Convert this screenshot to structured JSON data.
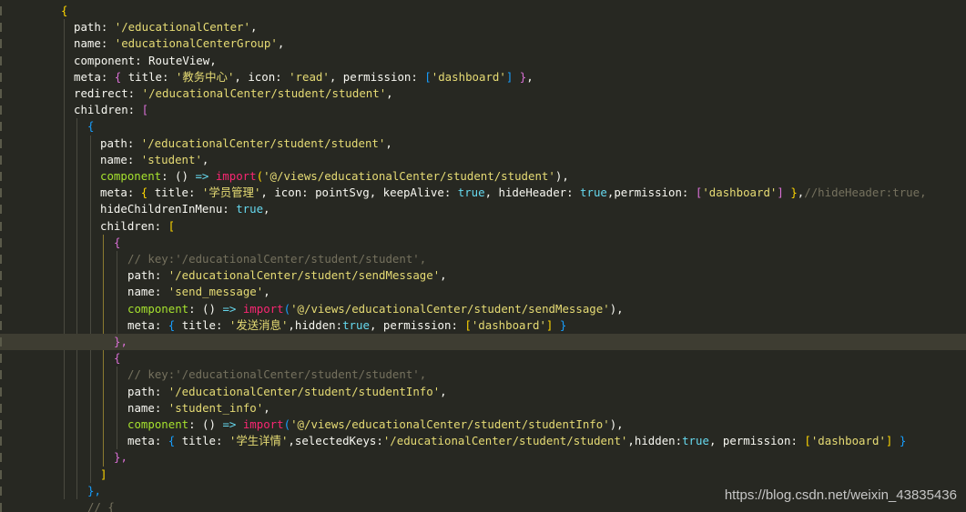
{
  "editor": {
    "theme_colors": {
      "background": "#272822",
      "string": "#e6db74",
      "keyword": "#66d9ef",
      "function": "#a6e22e",
      "comment": "#75715e",
      "import": "#f92672"
    },
    "lines": [
      [
        "{"
      ],
      [
        "path: ",
        "'/educationalCenter'",
        ","
      ],
      [
        "name: ",
        "'educationalCenterGroup'",
        ","
      ],
      [
        "component: RouteView,"
      ],
      [
        "meta: ",
        "{",
        " title: ",
        "'教务中心'",
        ", icon: ",
        "'read'",
        ", permission: ",
        "[",
        "'dashboard'",
        "]",
        " ",
        "}",
        ","
      ],
      [
        "redirect: ",
        "'/educationalCenter/student/student'",
        ","
      ],
      [
        "children: ",
        "["
      ],
      [
        "{"
      ],
      [
        "path: ",
        "'/educationalCenter/student/student'",
        ","
      ],
      [
        "name: ",
        "'student'",
        ","
      ],
      [
        "component",
        ": () ",
        "=>",
        " ",
        "import",
        "(",
        "'@/views/educationalCenter/student/student'",
        "),"
      ],
      [
        "meta: ",
        "{",
        " title: ",
        "'学员管理'",
        ", icon: pointSvg, keepAlive: ",
        "true",
        ", hideHeader: ",
        "true",
        ",permission: ",
        "[",
        "'dashboard'",
        "]",
        " ",
        "}",
        ",",
        "//hideHeader:true,"
      ],
      [
        "hideChildrenInMenu: ",
        "true",
        ","
      ],
      [
        "children: ",
        "["
      ],
      [
        "{"
      ],
      [
        "// key:'/educationalCenter/student/student',"
      ],
      [
        "path: ",
        "'/educationalCenter/student/sendMessage'",
        ","
      ],
      [
        "name: ",
        "'send_message'",
        ","
      ],
      [
        "component",
        ": () ",
        "=>",
        " ",
        "import",
        "(",
        "'@/views/educationalCenter/student/sendMessage'",
        "),"
      ],
      [
        "meta: ",
        "{",
        " title: ",
        "'发送消息'",
        ",hidden:",
        "true",
        ", permission: ",
        "[",
        "'dashboard'",
        "]",
        " ",
        "}"
      ],
      [
        "},"
      ],
      [
        "{"
      ],
      [
        "// key:'/educationalCenter/student/student',"
      ],
      [
        "path: ",
        "'/educationalCenter/student/studentInfo'",
        ","
      ],
      [
        "name: ",
        "'student_info'",
        ","
      ],
      [
        "component",
        ": () ",
        "=>",
        " ",
        "import",
        "(",
        "'@/views/educationalCenter/student/studentInfo'",
        "),"
      ],
      [
        "meta: ",
        "{",
        " title: ",
        "'学生详情'",
        ",selectedKeys:",
        "'/educationalCenter/student/student'",
        ",hidden:",
        "true",
        ", permission: ",
        "[",
        "'dashboard'",
        "]",
        " ",
        "}"
      ],
      [
        "},"
      ],
      [
        "]"
      ],
      [
        "},"
      ],
      [
        "// {"
      ]
    ]
  },
  "watermark": "https://blog.csdn.net/weixin_43835436"
}
